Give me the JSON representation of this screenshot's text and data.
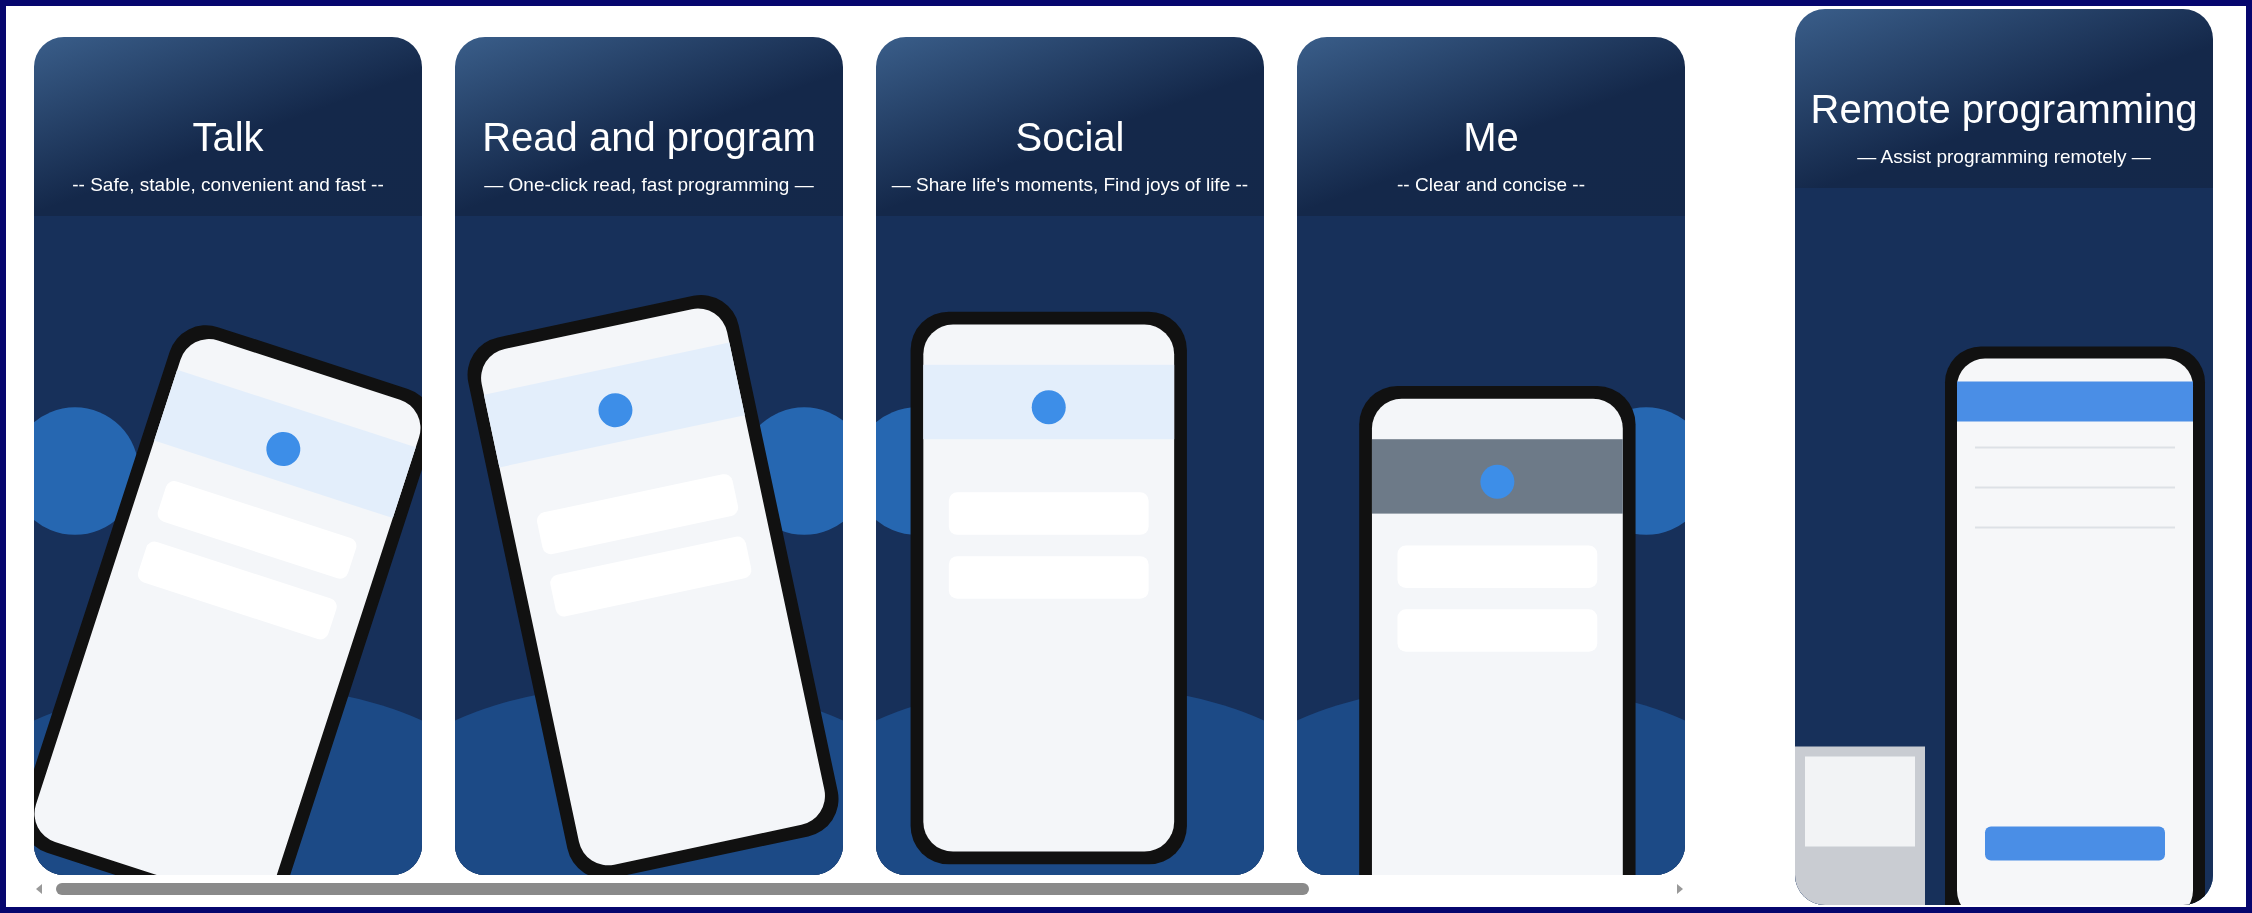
{
  "carousel": {
    "screenshots": [
      {
        "title": "Talk",
        "subtitle": "-- Safe, stable, convenient and fast --"
      },
      {
        "title": "Read and program",
        "subtitle": "— One-click read, fast programming —"
      },
      {
        "title": "Social",
        "subtitle": "— Share life's moments, Find joys of life --"
      },
      {
        "title": "Me",
        "subtitle": "-- Clear and concise --"
      }
    ]
  },
  "side_screenshot": {
    "title": "Remote programming",
    "subtitle": "— Assist programming remotely —"
  }
}
